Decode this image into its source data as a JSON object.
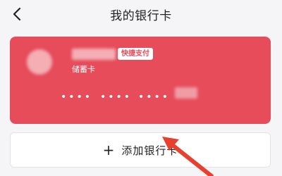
{
  "header": {
    "title": "我的银行卡",
    "back_icon": "chevron-left-icon"
  },
  "card": {
    "background_color": "#e64c5a",
    "badge": "快捷支付",
    "type": "储蓄卡",
    "masked_groups": [
      "••••",
      "••••",
      "••••"
    ]
  },
  "add_card": {
    "icon": "plus-icon",
    "label": "添加银行卡"
  },
  "annotation": {
    "arrow_color": "#e8402e"
  }
}
